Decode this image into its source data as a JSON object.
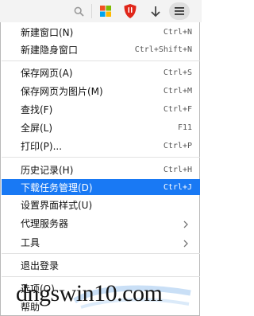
{
  "toolbar": {
    "icons": [
      "search-icon",
      "windows-logo-icon",
      "shield-icon",
      "download-icon",
      "menu-icon"
    ],
    "colors": {
      "windows_red": "#f25022",
      "windows_green": "#7fba00",
      "windows_blue": "#00a4ef",
      "windows_yellow": "#ffb900",
      "shield_red": "#e0261a"
    }
  },
  "menu": {
    "items": [
      {
        "label": "新建窗口(N)",
        "shortcut": "Ctrl+N"
      },
      {
        "label": "新建隐身窗口",
        "shortcut": "Ctrl+Shift+N"
      },
      {
        "label": "保存网页(A)",
        "shortcut": "Ctrl+S"
      },
      {
        "label": "保存网页为图片(M)",
        "shortcut": "Ctrl+M"
      },
      {
        "label": "查找(F)",
        "shortcut": "Ctrl+F"
      },
      {
        "label": "全屏(L)",
        "shortcut": "F11"
      },
      {
        "label": "打印(P)...",
        "shortcut": "Ctrl+P"
      },
      {
        "label": "历史记录(H)",
        "shortcut": "Ctrl+H"
      },
      {
        "label": "下载任务管理(D)",
        "shortcut": "Ctrl+J",
        "selected": true
      },
      {
        "label": "设置界面样式(U)",
        "shortcut": ""
      },
      {
        "label": "代理服务器",
        "shortcut": ""
      },
      {
        "label": "工具",
        "shortcut": ""
      },
      {
        "label": "退出登录",
        "shortcut": ""
      },
      {
        "label": "选项(O)",
        "shortcut": ""
      },
      {
        "label": "帮助",
        "shortcut": ""
      }
    ],
    "selected_color": "#1979f4"
  },
  "watermark": {
    "text": "dngswin10.com"
  }
}
